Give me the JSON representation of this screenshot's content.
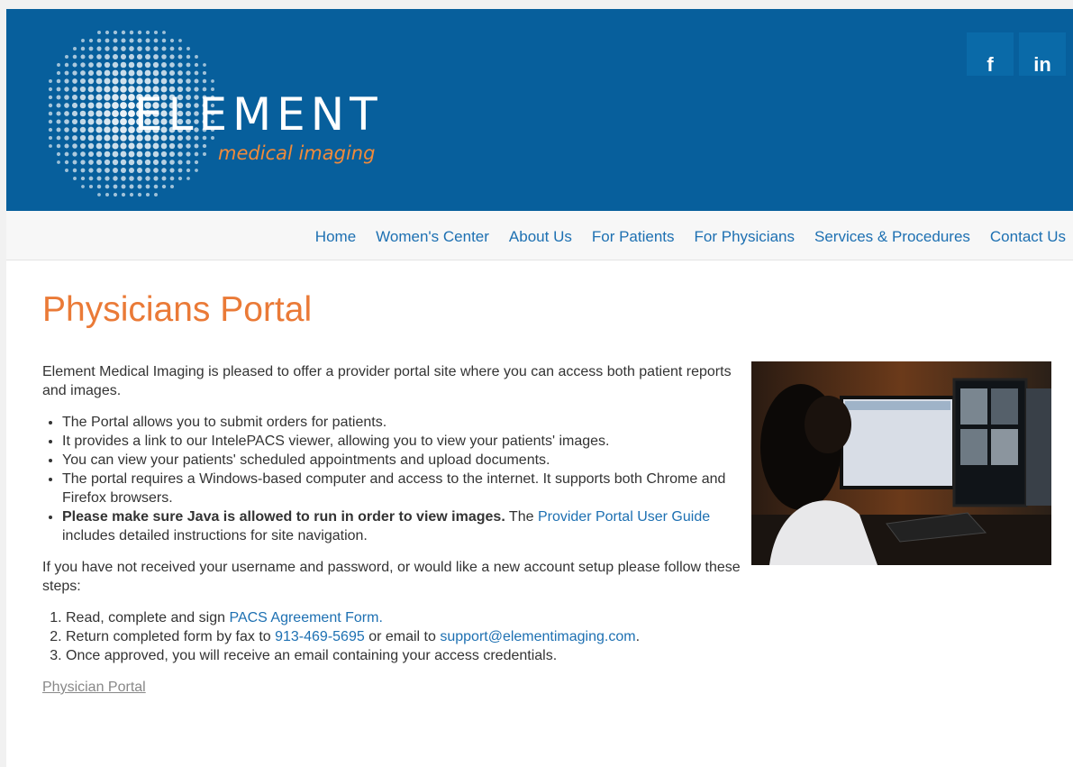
{
  "brand": {
    "name": "ELEMENT",
    "tagline": "medical imaging",
    "colors": {
      "header": "#075f9c",
      "accent": "#ea7a37",
      "link": "#1d70b2"
    }
  },
  "social": [
    {
      "label": "f",
      "icon": "facebook-icon"
    },
    {
      "label": "in",
      "icon": "linkedin-icon"
    }
  ],
  "nav": [
    "Home",
    "Women's Center",
    "About Us",
    "For Patients",
    "For Physicians",
    "Services & Procedures",
    "Contact Us"
  ],
  "page": {
    "title": "Physicians Portal",
    "intro": "Element Medical Imaging is pleased to offer a provider portal site where you can access both patient reports and images.",
    "bullets": [
      "The Portal allows you to submit orders for patients.",
      "It provides a link to our IntelePACS viewer, allowing you to view your patients' images.",
      "You can view your patients' scheduled appointments and upload documents.",
      "The portal requires a Windows-based computer and access to the internet. It supports both Chrome and Firefox browsers."
    ],
    "java_bold": "Please make sure Java is allowed to run in order to view images.",
    "java_the": " The ",
    "guide_link": "Provider Portal User Guide",
    "guide_rest": " includes detailed instructions for site navigation.",
    "steps_intro": "If you have not received your username and password, or would like a new account setup please follow these steps:",
    "step1_text": "Read, complete and sign ",
    "step1_link": "PACS Agreement Form.",
    "step2_text": "Return completed form by fax to ",
    "step2_fax": "913-469-5695",
    "step2_mid": " or email to ",
    "step2_email": "support@elementimaging.com",
    "step2_end": ".",
    "step3_text": "Once approved, you will receive an email containing your access credentials.",
    "portal_link": "Physician Portal"
  }
}
